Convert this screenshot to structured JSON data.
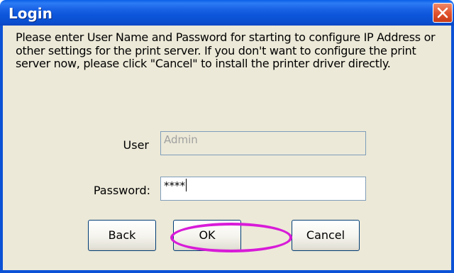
{
  "window": {
    "title": "Login"
  },
  "message": "Please enter User Name and Password for starting to configure IP Address or other settings for the print server. If you don't want to configure the print server now, please click \"Cancel\" to install the printer driver directly.",
  "form": {
    "user_label": "User",
    "user_value": "Admin",
    "password_label": "Password:",
    "password_value": "****"
  },
  "buttons": {
    "back": "Back",
    "ok": "OK",
    "cancel": "Cancel"
  },
  "colors": {
    "titlebar": "#0a55dc",
    "dialog_bg": "#ece9d8",
    "highlight": "#d81bd8",
    "close": "#e0512c"
  }
}
